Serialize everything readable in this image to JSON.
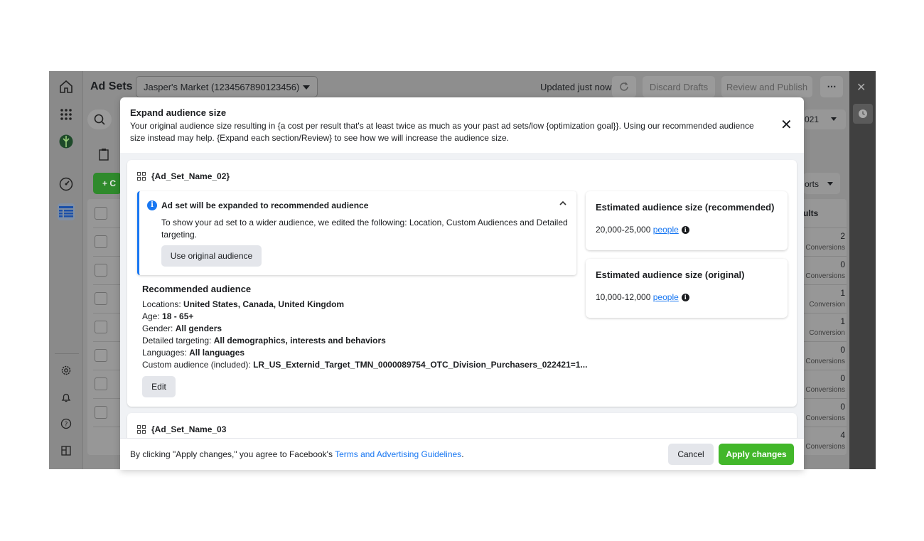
{
  "app": {
    "title": "Ad Sets",
    "account_selector": "Jasper's Market (1234567890123456)",
    "updated_status": "Updated just now",
    "discard_label": "Discard Drafts",
    "review_label": "Review and Publish",
    "more_label": "⋯",
    "date_fragment": "021",
    "reports_fragment": "orts",
    "results_header_fragment": "ults",
    "create_fragment": "+ C"
  },
  "background_rows": [
    {
      "value": "2",
      "label": "Conversions"
    },
    {
      "value": "0",
      "label": "Conversions"
    },
    {
      "value": "1",
      "label": "Conversion"
    },
    {
      "value": "1",
      "label": "Conversion"
    },
    {
      "value": "0",
      "label": "Conversions"
    },
    {
      "value": "0",
      "label": "Conversions"
    },
    {
      "value": "0",
      "label": "Conversions"
    },
    {
      "value": "4",
      "label": "Conversions"
    }
  ],
  "modal": {
    "title": "Expand audience size",
    "description": "Your original audience size resulting in {a cost per result that's at least twice as much as your past ad sets/low {optimization goal}}. Using our recommended audience size instead may help. {Expand each section/Review} to see how we will increase the audience size.",
    "close_label": "✕",
    "ad_set_1": {
      "name": "{Ad_Set_Name_02}",
      "notice_title": "Ad set will be expanded to recommended audience",
      "notice_text": "To show your ad set to a wider audience, we edited the following: Location, Custom Audiences and Detailed targeting.",
      "use_original_label": "Use original audience",
      "recommended_title": "Recommended audience",
      "details": {
        "locations_label": "Locations:",
        "locations_value": "United States, Canada, United Kingdom",
        "age_label": "Age:",
        "age_value": "18 - 65+",
        "gender_label": "Gender:",
        "gender_value": "All genders",
        "detailed_label": "Detailed targeting:",
        "detailed_value": "All demographics, interests and behaviors",
        "languages_label": "Languages:",
        "languages_value": "All languages",
        "custom_label": "Custom audience (included):",
        "custom_value": "LR_US_Externid_Target_TMN_0000089754_OTC_Division_Purchasers_022421=1..."
      },
      "edit_label": "Edit",
      "estimate_recommended": {
        "title": "Estimated audience size (recommended)",
        "range": "20,000-25,000",
        "unit": "people"
      },
      "estimate_original": {
        "title": "Estimated audience size (original)",
        "range": "10,000-12,000",
        "unit": "people"
      }
    },
    "ad_set_2": {
      "name": "{Ad_Set_Name_03"
    },
    "footer": {
      "text": "By clicking \"Apply changes,\" you agree to Facebook's",
      "link": "Terms and Advertising Guidelines",
      "period": ".",
      "cancel_label": "Cancel",
      "apply_label": "Apply changes"
    }
  },
  "colors": {
    "accent_blue": "#1877f2",
    "apply_green": "#42b72a",
    "overlay_gray": "#8e8e8e"
  }
}
